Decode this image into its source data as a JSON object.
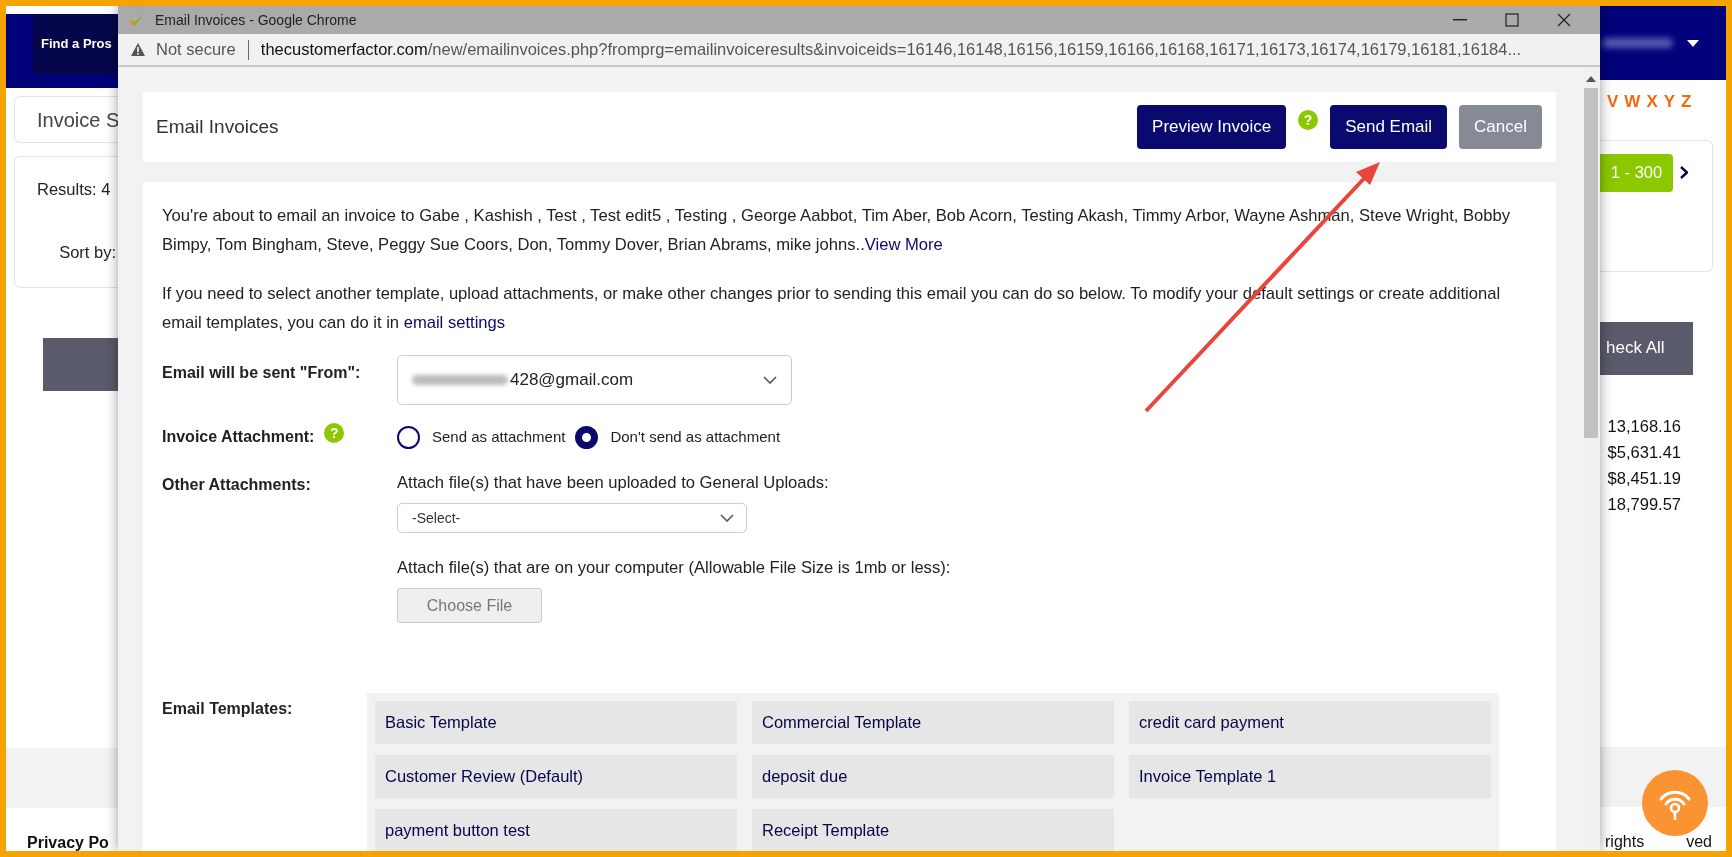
{
  "background_page": {
    "header_button": "Find a Pros",
    "page_title": "Invoice S",
    "results_label": "Results: 4",
    "sort_label": "Sort by:",
    "alphabet_letters": [
      "V",
      "W",
      "X",
      "Y",
      "Z"
    ],
    "pagination_range": "1 - 300",
    "check_all_button": "heck All",
    "amounts": [
      "13,168.16",
      "$5,631.41",
      "$8,451.19",
      "18,799.57"
    ],
    "footer_link": "Privacy Po",
    "footer_text": [
      "rights",
      "ved"
    ]
  },
  "popup": {
    "window_title": "Email Invoices - Google Chrome",
    "security_label": "Not secure",
    "url_domain": "thecustomerfactor.com",
    "url_path": "/new/emailinvoices.php?fromprg=emailinvoiceresults&invoiceids=16146,16148,16156,16159,16166,16168,16171,16173,16174,16179,16181,16184...",
    "heading": "Email Invoices",
    "buttons": [
      {
        "kind": "primary",
        "label": "Preview Invoice"
      },
      {
        "kind": "help",
        "label": "?"
      },
      {
        "kind": "primary",
        "label": "Send Email"
      },
      {
        "kind": "secondary",
        "label": "Cancel"
      }
    ],
    "recipients_text": "You're about to email an invoice to Gabe , Kashish , Test , Test edit5 , Testing , George Aabbot, Tim Aber, Bob Acorn, Testing Akash, Timmy Arbor, Wayne Ashman, Steve Wright, Bobby Bimpy, Tom Bingham, Steve, Peggy Sue Coors, Don, Tommy Dover, Brian Abrams, mike johns..",
    "view_more_link": "View More",
    "info_text": "If you need to select another template, upload attachments, or make other changes prior to sending this email you can do so below. To modify your default settings or create additional email templates, you can do it in",
    "settings_link": "email settings",
    "from": {
      "label": "Email will be sent \"From\":",
      "value": "428@gmail.com"
    },
    "invoice_attachment": {
      "label": "Invoice Attachment:",
      "help": "?",
      "options": [
        {
          "label": "Send as attachment",
          "selected": false
        },
        {
          "label": "Don't send as attachment",
          "selected": true
        }
      ]
    },
    "other_attachments": {
      "label": "Other Attachments:",
      "uploads_hint": "Attach file(s) that have been uploaded to General Uploads:",
      "uploads_select": "-Select-",
      "computer_hint": "Attach file(s) that are on your computer (Allowable File Size is 1mb or less):",
      "file_button": "Choose File"
    },
    "templates": {
      "label": "Email Templates:",
      "items": [
        "Basic Template",
        "Commercial Template",
        "credit card payment",
        "Customer Review (Default)",
        "deposit due",
        "Invoice Template 1",
        "payment button test",
        "Receipt Template"
      ]
    }
  }
}
